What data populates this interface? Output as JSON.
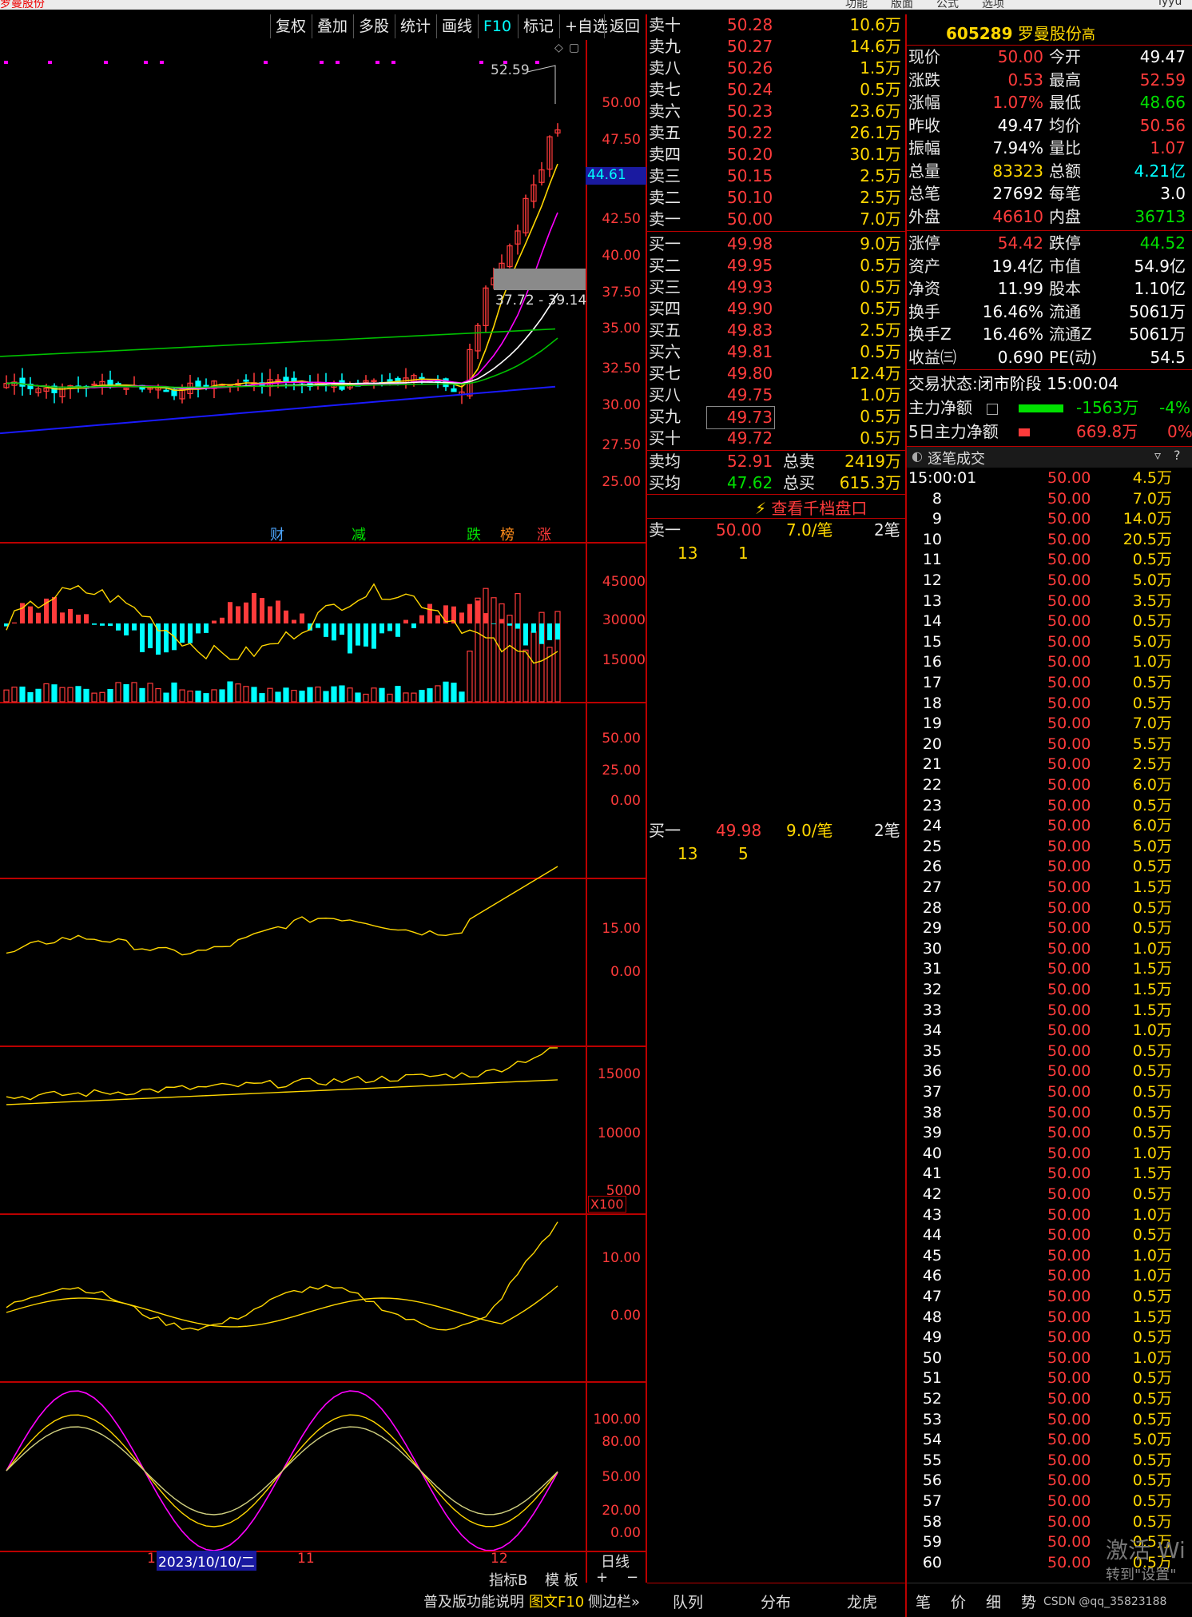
{
  "app": {
    "window_title": "罗曼股份",
    "top_menu": [
      "功能",
      "版面",
      "公式",
      "选项",
      "lyyu"
    ]
  },
  "toolbar": [
    "复权",
    "叠加",
    "多股",
    "统计",
    "画线",
    "F10",
    "标记",
    "+自选",
    "返回"
  ],
  "kline": {
    "high_label": "52.59",
    "price_ticks": [
      "50.00",
      "47.50",
      "44.61",
      "42.50",
      "40.00",
      "37.50",
      "35.00",
      "32.50",
      "30.00",
      "27.50",
      "25.00"
    ],
    "current_marker": "44.61",
    "range_label": "37.72 - 39.14",
    "event_tags": [
      {
        "text": "财",
        "color": "#4da6ff"
      },
      {
        "text": "减",
        "color": "#00e000"
      },
      {
        "text": "跌",
        "color": "#00e000"
      },
      {
        "text": "榜",
        "color": "#ff8c1a"
      },
      {
        "text": "涨",
        "color": "#ff3b3b"
      }
    ]
  },
  "volume": {
    "ticks": [
      "45000",
      "30000",
      "15000"
    ]
  },
  "macd": {
    "ticks": [
      "50.00",
      "25.00",
      "0.00"
    ]
  },
  "ind3": {
    "ticks": [
      "15.00",
      "0.00"
    ]
  },
  "ind4": {
    "ticks": [
      "15000",
      "10000",
      "5000"
    ],
    "unit": "X100"
  },
  "ind5": {
    "ticks": [
      "10.00",
      "0.00"
    ]
  },
  "kdj": {
    "ticks": [
      "100.00",
      "80.00",
      "50.00",
      "20.00",
      "0.00"
    ]
  },
  "date_axis": {
    "labels": [
      "1",
      "2023/10/10/二",
      "11",
      "12"
    ],
    "period": "日线"
  },
  "bottom_left": {
    "buttons": [
      "指标B",
      "模 板",
      "+",
      "−"
    ],
    "footer": [
      "普及版功能说明",
      "图文F10",
      "侧边栏»"
    ]
  },
  "order_book": {
    "sell": [
      {
        "label": "卖十",
        "price": "50.28",
        "vol": "10.6万"
      },
      {
        "label": "卖九",
        "price": "50.27",
        "vol": "14.6万"
      },
      {
        "label": "卖八",
        "price": "50.26",
        "vol": "1.5万"
      },
      {
        "label": "卖七",
        "price": "50.24",
        "vol": "0.5万"
      },
      {
        "label": "卖六",
        "price": "50.23",
        "vol": "23.6万"
      },
      {
        "label": "卖五",
        "price": "50.22",
        "vol": "26.1万"
      },
      {
        "label": "卖四",
        "price": "50.20",
        "vol": "30.1万"
      },
      {
        "label": "卖三",
        "price": "50.15",
        "vol": "2.5万"
      },
      {
        "label": "卖二",
        "price": "50.10",
        "vol": "2.5万"
      },
      {
        "label": "卖一",
        "price": "50.00",
        "vol": "7.0万"
      }
    ],
    "buy": [
      {
        "label": "买一",
        "price": "49.98",
        "vol": "9.0万"
      },
      {
        "label": "买二",
        "price": "49.95",
        "vol": "0.5万"
      },
      {
        "label": "买三",
        "price": "49.93",
        "vol": "0.5万"
      },
      {
        "label": "买四",
        "price": "49.90",
        "vol": "0.5万"
      },
      {
        "label": "买五",
        "price": "49.83",
        "vol": "2.5万"
      },
      {
        "label": "买六",
        "price": "49.81",
        "vol": "0.5万"
      },
      {
        "label": "买七",
        "price": "49.80",
        "vol": "12.4万"
      },
      {
        "label": "买八",
        "price": "49.75",
        "vol": "1.0万"
      },
      {
        "label": "买九",
        "price": "49.73",
        "vol": "0.5万"
      },
      {
        "label": "买十",
        "price": "49.72",
        "vol": "0.5万"
      }
    ],
    "avg": [
      {
        "label": "卖均",
        "price": "52.91",
        "k": "总卖",
        "v": "2419万"
      },
      {
        "label": "买均",
        "price": "47.62",
        "k": "总买",
        "v": "615.3万"
      }
    ],
    "view_link": "查看千档盘口",
    "sell1_detail": {
      "label": "卖一",
      "price": "50.00",
      "vol": "7.0/笔",
      "cnt": "2笔",
      "q1": "13",
      "q2": "1"
    },
    "buy1_detail": {
      "label": "买一",
      "price": "49.98",
      "vol": "9.0/笔",
      "cnt": "2笔",
      "q1": "13",
      "q2": "5"
    },
    "bottom_tabs": [
      "队列",
      "分布",
      "龙虎"
    ]
  },
  "quote": {
    "code": "605289",
    "name": "罗曼股份",
    "tag": "高",
    "rows": [
      {
        "k1": "现价",
        "v1": "50.00",
        "c1": "#ff3b3b",
        "k2": "今开",
        "v2": "49.47",
        "c2": "#ffffff"
      },
      {
        "k1": "涨跌",
        "v1": "0.53",
        "c1": "#ff3b3b",
        "k2": "最高",
        "v2": "52.59",
        "c2": "#ff3b3b"
      },
      {
        "k1": "涨幅",
        "v1": "1.07%",
        "c1": "#ff3b3b",
        "k2": "最低",
        "v2": "48.66",
        "c2": "#00e000"
      },
      {
        "k1": "昨收",
        "v1": "49.47",
        "c1": "#ffffff",
        "k2": "均价",
        "v2": "50.56",
        "c2": "#ff3b3b"
      },
      {
        "k1": "振幅",
        "v1": "7.94%",
        "c1": "#ffffff",
        "k2": "量比",
        "v2": "1.07",
        "c2": "#ff3b3b"
      },
      {
        "k1": "总量",
        "v1": "83323",
        "c1": "#ffd700",
        "k2": "总额",
        "v2": "4.21亿",
        "c2": "#00ffff"
      },
      {
        "k1": "总笔",
        "v1": "27692",
        "c1": "#ffffff",
        "k2": "每笔",
        "v2": "3.0",
        "c2": "#ffffff"
      },
      {
        "k1": "外盘",
        "v1": "46610",
        "c1": "#ff3b3b",
        "k2": "内盘",
        "v2": "36713",
        "c2": "#00e000"
      }
    ],
    "rows2": [
      {
        "k1": "涨停",
        "v1": "54.42",
        "c1": "#ff3b3b",
        "k2": "跌停",
        "v2": "44.52",
        "c2": "#00e000"
      },
      {
        "k1": "资产",
        "v1": "19.4亿",
        "c1": "#ffffff",
        "k2": "市值",
        "v2": "54.9亿",
        "c2": "#ffffff"
      },
      {
        "k1": "净资",
        "v1": "11.99",
        "c1": "#ffffff",
        "k2": "股本",
        "v2": "1.10亿",
        "c2": "#ffffff"
      },
      {
        "k1": "换手",
        "v1": "16.46%",
        "c1": "#ffffff",
        "k2": "流通",
        "v2": "5061万",
        "c2": "#ffffff"
      },
      {
        "k1": "换手Z",
        "v1": "16.46%",
        "c1": "#ffffff",
        "k2": "流通Z",
        "v2": "5061万",
        "c2": "#ffffff"
      },
      {
        "k1": "收益㈢",
        "v1": "0.690",
        "c1": "#ffffff",
        "k2": "PE(动)",
        "v2": "54.5",
        "c2": "#ffffff"
      }
    ],
    "status_label": "交易状态:",
    "status_value": "闭市阶段 15:00:04",
    "main_net": {
      "label": "主力净额",
      "value": "-1563万",
      "pct": "-4%"
    },
    "main_net5": {
      "label": "5日主力净额",
      "value": "669.8万",
      "pct": "0%"
    },
    "ticks_title": "逐笔成交",
    "ticks": [
      [
        "15:00:01",
        "50.00",
        "4.5万"
      ],
      [
        "8",
        "50.00",
        "7.0万"
      ],
      [
        "9",
        "50.00",
        "14.0万"
      ],
      [
        "10",
        "50.00",
        "20.5万"
      ],
      [
        "11",
        "50.00",
        "0.5万"
      ],
      [
        "12",
        "50.00",
        "5.0万"
      ],
      [
        "13",
        "50.00",
        "3.5万"
      ],
      [
        "14",
        "50.00",
        "0.5万"
      ],
      [
        "15",
        "50.00",
        "5.0万"
      ],
      [
        "16",
        "50.00",
        "1.0万"
      ],
      [
        "17",
        "50.00",
        "0.5万"
      ],
      [
        "18",
        "50.00",
        "0.5万"
      ],
      [
        "19",
        "50.00",
        "7.0万"
      ],
      [
        "20",
        "50.00",
        "5.5万"
      ],
      [
        "21",
        "50.00",
        "2.5万"
      ],
      [
        "22",
        "50.00",
        "6.0万"
      ],
      [
        "23",
        "50.00",
        "0.5万"
      ],
      [
        "24",
        "50.00",
        "6.0万"
      ],
      [
        "25",
        "50.00",
        "5.0万"
      ],
      [
        "26",
        "50.00",
        "0.5万"
      ],
      [
        "27",
        "50.00",
        "1.5万"
      ],
      [
        "28",
        "50.00",
        "0.5万"
      ],
      [
        "29",
        "50.00",
        "0.5万"
      ],
      [
        "30",
        "50.00",
        "1.0万"
      ],
      [
        "31",
        "50.00",
        "1.5万"
      ],
      [
        "32",
        "50.00",
        "1.5万"
      ],
      [
        "33",
        "50.00",
        "1.5万"
      ],
      [
        "34",
        "50.00",
        "1.0万"
      ],
      [
        "35",
        "50.00",
        "0.5万"
      ],
      [
        "36",
        "50.00",
        "0.5万"
      ],
      [
        "37",
        "50.00",
        "0.5万"
      ],
      [
        "38",
        "50.00",
        "0.5万"
      ],
      [
        "39",
        "50.00",
        "0.5万"
      ],
      [
        "40",
        "50.00",
        "1.0万"
      ],
      [
        "41",
        "50.00",
        "1.5万"
      ],
      [
        "42",
        "50.00",
        "0.5万"
      ],
      [
        "43",
        "50.00",
        "1.0万"
      ],
      [
        "44",
        "50.00",
        "0.5万"
      ],
      [
        "45",
        "50.00",
        "1.0万"
      ],
      [
        "46",
        "50.00",
        "1.0万"
      ],
      [
        "47",
        "50.00",
        "0.5万"
      ],
      [
        "48",
        "50.00",
        "1.5万"
      ],
      [
        "49",
        "50.00",
        "0.5万"
      ],
      [
        "50",
        "50.00",
        "1.0万"
      ],
      [
        "51",
        "50.00",
        "0.5万"
      ],
      [
        "52",
        "50.00",
        "0.5万"
      ],
      [
        "53",
        "50.00",
        "0.5万"
      ],
      [
        "54",
        "50.00",
        "5.0万"
      ],
      [
        "55",
        "50.00",
        "0.5万"
      ],
      [
        "56",
        "50.00",
        "0.5万"
      ],
      [
        "57",
        "50.00",
        "0.5万"
      ],
      [
        "58",
        "50.00",
        "0.5万"
      ],
      [
        "59",
        "50.00",
        "0.5万"
      ],
      [
        "60",
        "50.00",
        "0.5万"
      ]
    ],
    "bottom_tabs": [
      "笔",
      "价",
      "细",
      "势"
    ],
    "watermark1": "激活 Wi",
    "watermark2": "转到\"设置\"",
    "csdn": "CSDN @qq_35823188"
  },
  "colors": {
    "up": "#ff3b3b",
    "down": "#00ffff",
    "border": "#b00000",
    "ma1": "#ffffff",
    "ma2": "#ffd700",
    "ma3": "#ff00ff",
    "ma4": "#00c000",
    "ma5": "#1a1aff"
  }
}
